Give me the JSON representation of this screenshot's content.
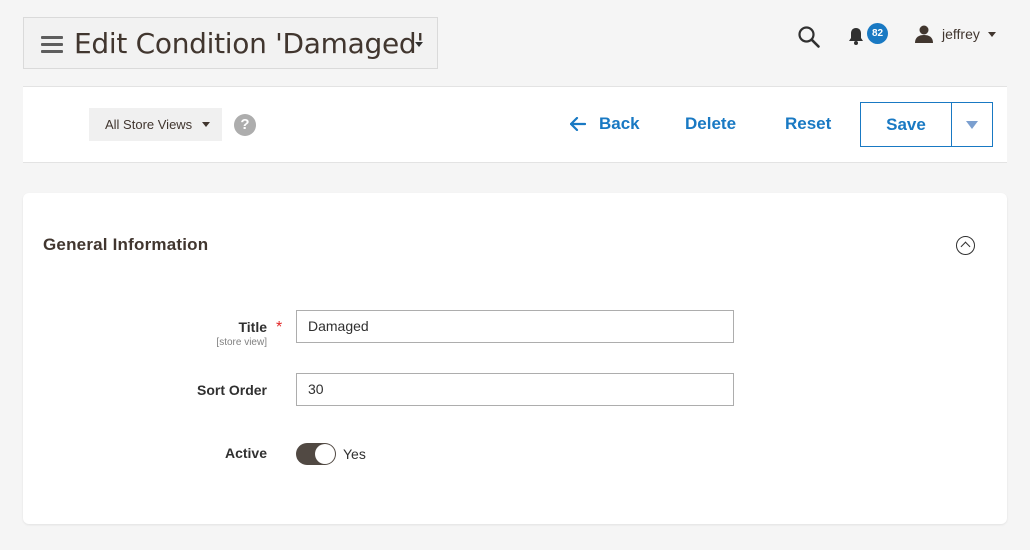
{
  "header": {
    "title": "Edit Condition 'Damaged'",
    "notifications_count": "82",
    "user_name": "jeffrey"
  },
  "action_bar": {
    "store_switcher": "All Store Views",
    "help": "?",
    "back_label": "Back",
    "delete_label": "Delete",
    "reset_label": "Reset",
    "save_label": "Save"
  },
  "section": {
    "title": "General Information",
    "fields": {
      "title_label": "Title",
      "title_scope": "[store view]",
      "title_required": "*",
      "title_value": "Damaged",
      "sort_order_label": "Sort Order",
      "sort_order_value": "30",
      "active_label": "Active",
      "active_value": "Yes"
    }
  },
  "icons": {
    "menu": "hamburger-icon",
    "search": "search-icon",
    "notifications": "bell-icon",
    "user": "user-icon",
    "back": "arrow-left-icon",
    "collapse": "chevron-up-circle-icon"
  },
  "colors": {
    "accent": "#1979c3",
    "badge": "#1979c3",
    "toggle_on": "#514943",
    "required": "#e22626"
  }
}
